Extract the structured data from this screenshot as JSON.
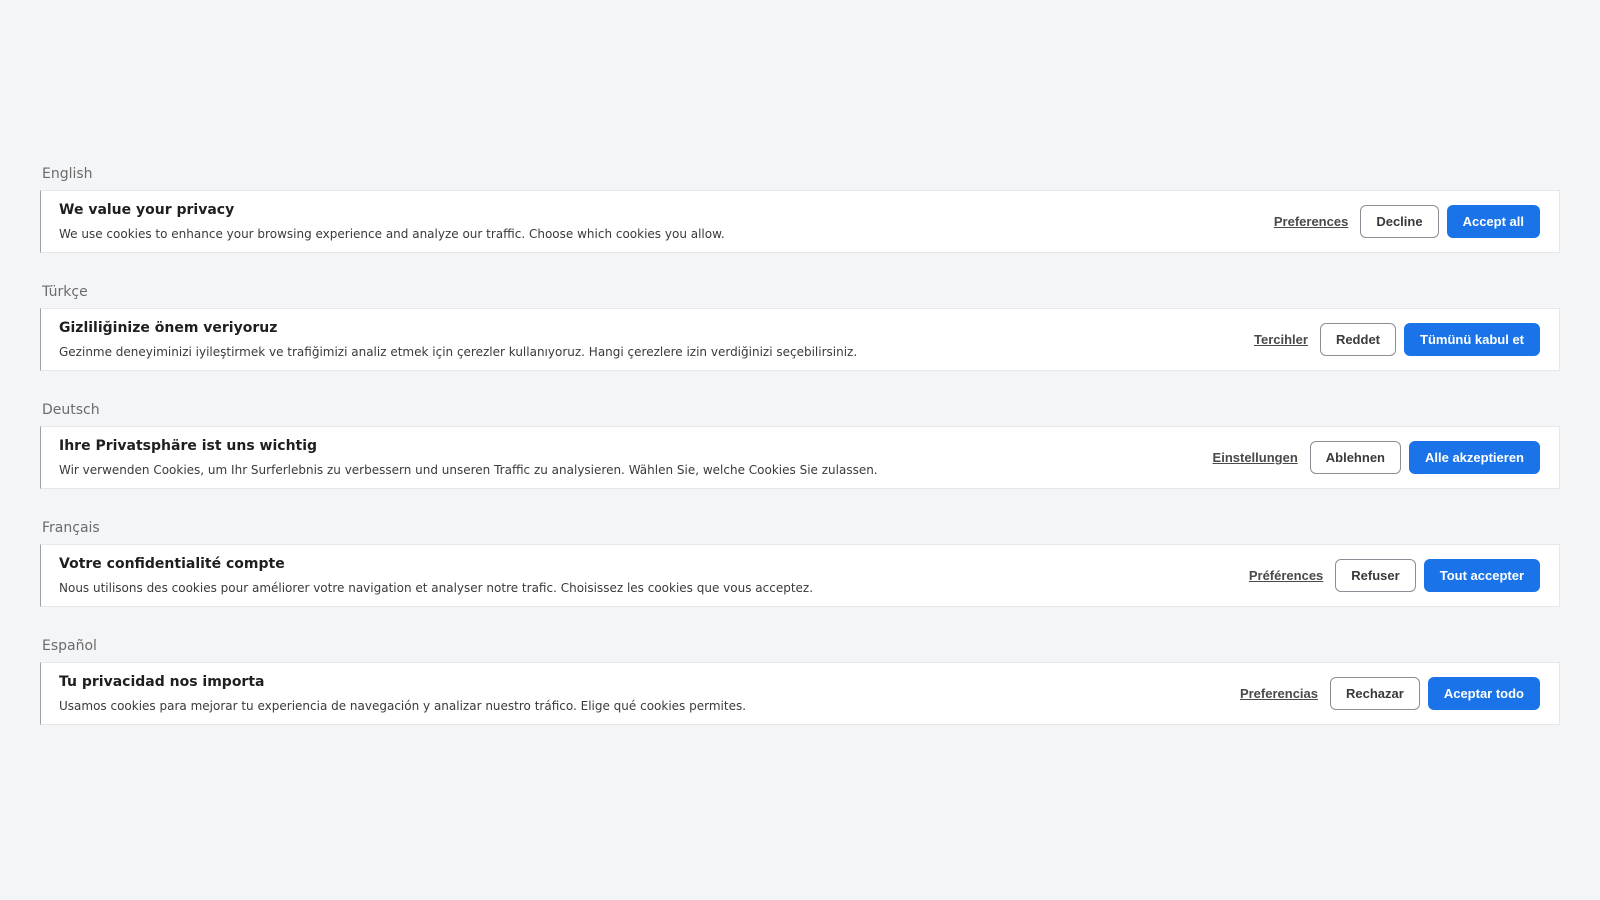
{
  "banners": [
    {
      "language": "English",
      "title": "We value your privacy",
      "body": "We use cookies to enhance your browsing experience and analyze our traffic. Choose which cookies you allow.",
      "preferences_label": "Preferences",
      "decline_label": "Decline",
      "accept_label": "Accept all"
    },
    {
      "language": "Türkçe",
      "title": "Gizliliğinize önem veriyoruz",
      "body": "Gezinme deneyiminizi iyileştirmek ve trafiğimizi analiz etmek için çerezler kullanıyoruz. Hangi çerezlere izin verdiğinizi seçebilirsiniz.",
      "preferences_label": "Tercihler",
      "decline_label": "Reddet",
      "accept_label": "Tümünü kabul et"
    },
    {
      "language": "Deutsch",
      "title": "Ihre Privatsphäre ist uns wichtig",
      "body": "Wir verwenden Cookies, um Ihr Surferlebnis zu verbessern und unseren Traffic zu analysieren. Wählen Sie, welche Cookies Sie zulassen.",
      "preferences_label": "Einstellungen",
      "decline_label": "Ablehnen",
      "accept_label": "Alle akzeptieren"
    },
    {
      "language": "Français",
      "title": "Votre confidentialité compte",
      "body": "Nous utilisons des cookies pour améliorer votre navigation et analyser notre trafic. Choisissez les cookies que vous acceptez.",
      "preferences_label": "Préférences",
      "decline_label": "Refuser",
      "accept_label": "Tout accepter"
    },
    {
      "language": "Español",
      "title": "Tu privacidad nos importa",
      "body": "Usamos cookies para mejorar tu experiencia de navegación y analizar nuestro tráfico. Elige qué cookies permites.",
      "preferences_label": "Preferencias",
      "decline_label": "Rechazar",
      "accept_label": "Aceptar todo"
    }
  ],
  "colors": {
    "accent": "#1a73e8",
    "page_background": "#f4f5f7",
    "banner_background": "#ffffff"
  }
}
